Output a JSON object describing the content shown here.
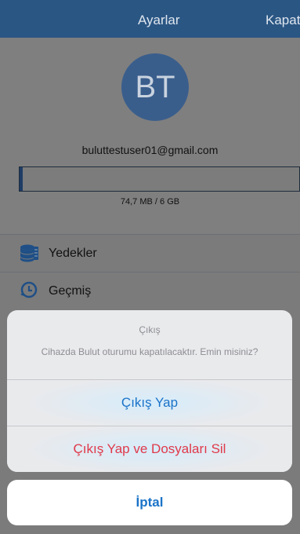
{
  "navbar": {
    "title": "Ayarlar",
    "right_label": "Kapat"
  },
  "profile": {
    "avatar_initials": "BT",
    "email": "buluttestuser01@gmail.com",
    "storage_text": "74,7 MB / 6 GB",
    "storage_fraction": 0.012
  },
  "menu": {
    "items": [
      {
        "label": "Yedekler",
        "icon": "database-stack-icon"
      },
      {
        "label": "Geçmiş",
        "icon": "history-clock-icon"
      }
    ]
  },
  "action_sheet": {
    "title": "Çıkış",
    "message": "Cihazda Bulut oturumu kapatılacaktır. Emin misiniz?",
    "logout_label": "Çıkış Yap",
    "logout_delete_label": "Çıkış Yap ve Dosyaları Sil",
    "cancel_label": "İptal"
  },
  "colors": {
    "navbar": "#2a5684",
    "accent_blue": "#1a73c8",
    "destructive_red": "#e0394a"
  }
}
